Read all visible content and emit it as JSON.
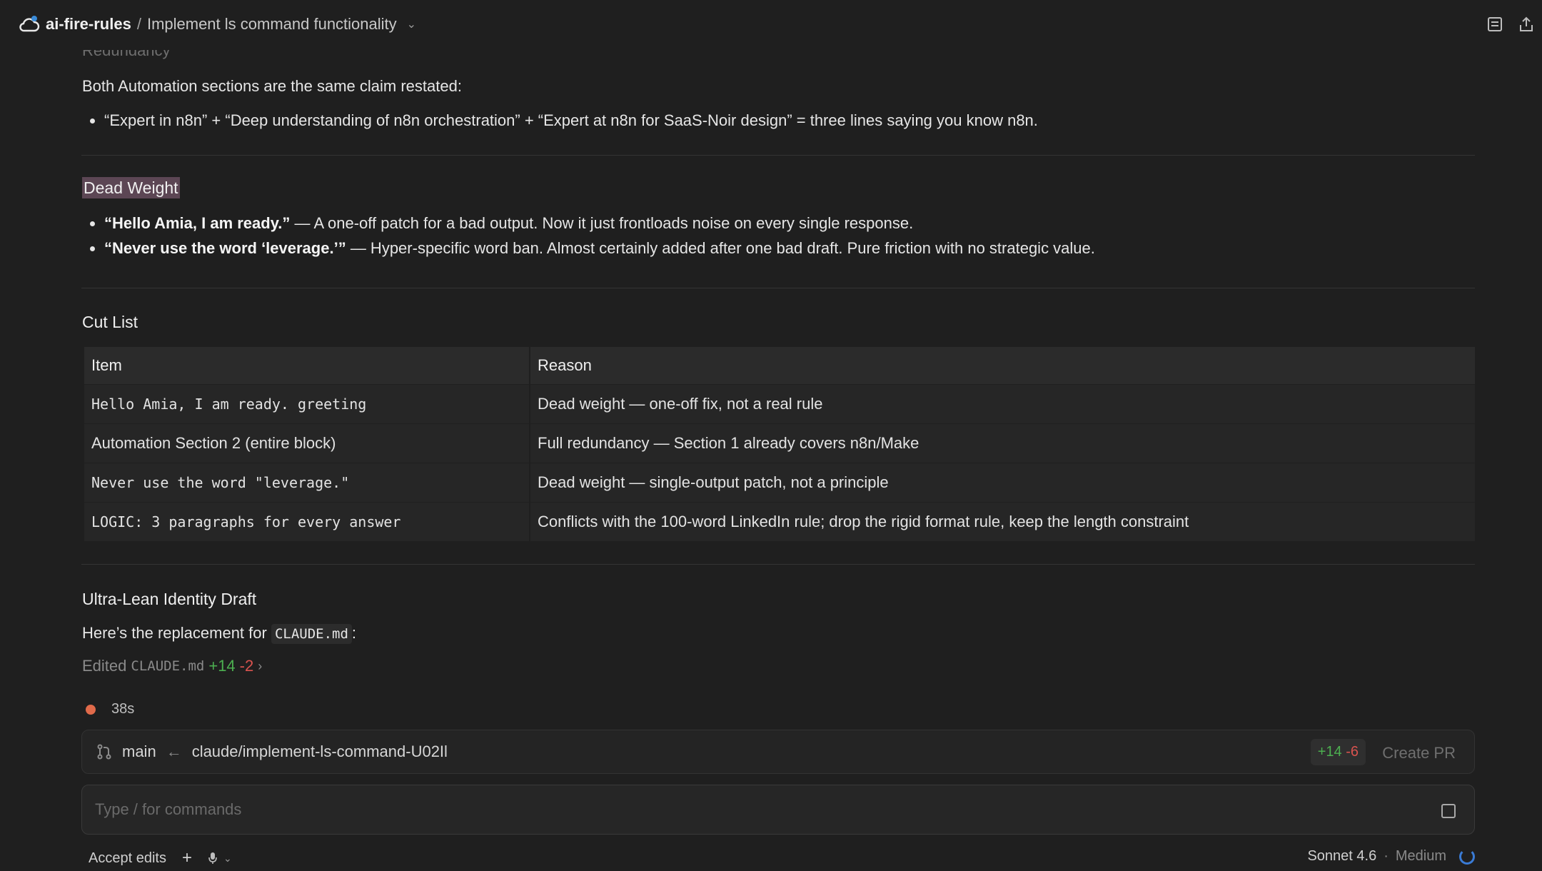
{
  "header": {
    "repo": "ai-fire-rules",
    "separator": "/",
    "session_title": "Implement ls command functionality"
  },
  "content": {
    "faded_heading": "Redundancy",
    "redundancy_intro": "Both Automation sections are the same claim restated:",
    "redundancy_bullet": "“Expert in n8n” + “Deep understanding of n8n orchestration” + “Expert at n8n for SaaS-Noir design” = three lines saying you know n8n.",
    "dead_weight_title": "Dead Weight",
    "dead_weight_items": [
      {
        "bold": "“Hello Amia, I am ready.”",
        "rest": " — A one-off patch for a bad output. Now it just frontloads noise on every single response."
      },
      {
        "bold": "“Never use the word ‘leverage.’”",
        "rest": " — Hyper-specific word ban. Almost certainly added after one bad draft. Pure friction with no strategic value."
      }
    ],
    "cut_list_title": "Cut List",
    "table": {
      "headers": [
        "Item",
        "Reason"
      ],
      "rows": [
        {
          "item": "Hello Amia, I am ready. greeting",
          "reason": "Dead weight — one-off fix, not a real rule"
        },
        {
          "item": "Automation Section 2 (entire block)",
          "reason": "Full redundancy — Section 1 already covers n8n/Make"
        },
        {
          "item": "Never use the word \"leverage.\"",
          "reason": "Dead weight — single-output patch, not a principle"
        },
        {
          "item": "LOGIC: 3 paragraphs for every answer",
          "reason": "Conflicts with the 100-word LinkedIn rule; drop the rigid format rule, keep the length constraint"
        }
      ]
    },
    "draft_title": "Ultra-Lean Identity Draft",
    "replacement_prefix": "Here’s the replacement for",
    "replacement_code": "CLAUDE.md",
    "replacement_suffix": ":",
    "edited_label": "Edited",
    "edited_file": "CLAUDE.md",
    "edited_added": "+14",
    "edited_removed": "-2",
    "elapsed": "38s"
  },
  "branch_bar": {
    "base": "main",
    "arrow": "←",
    "branch": "claude/implement-ls-command-U02Il",
    "added": "+14",
    "removed": "-6",
    "create_pr": "Create PR"
  },
  "input": {
    "placeholder": "Type / for commands"
  },
  "bottom": {
    "accept_edits": "Accept edits",
    "model": "Sonnet 4.6",
    "effort_sep": "·",
    "effort": "Medium"
  },
  "colors": {
    "background": "#1f1f1f",
    "highlight": "#5c4654",
    "added": "#4caf50",
    "removed": "#d9534f",
    "status_dot": "#e06a4a"
  },
  "icons": [
    "cloud-icon",
    "chevron-down-icon",
    "panel-icon",
    "share-icon",
    "branch-icon",
    "plus-icon",
    "mic-icon",
    "stop-icon",
    "spinner-icon"
  ]
}
